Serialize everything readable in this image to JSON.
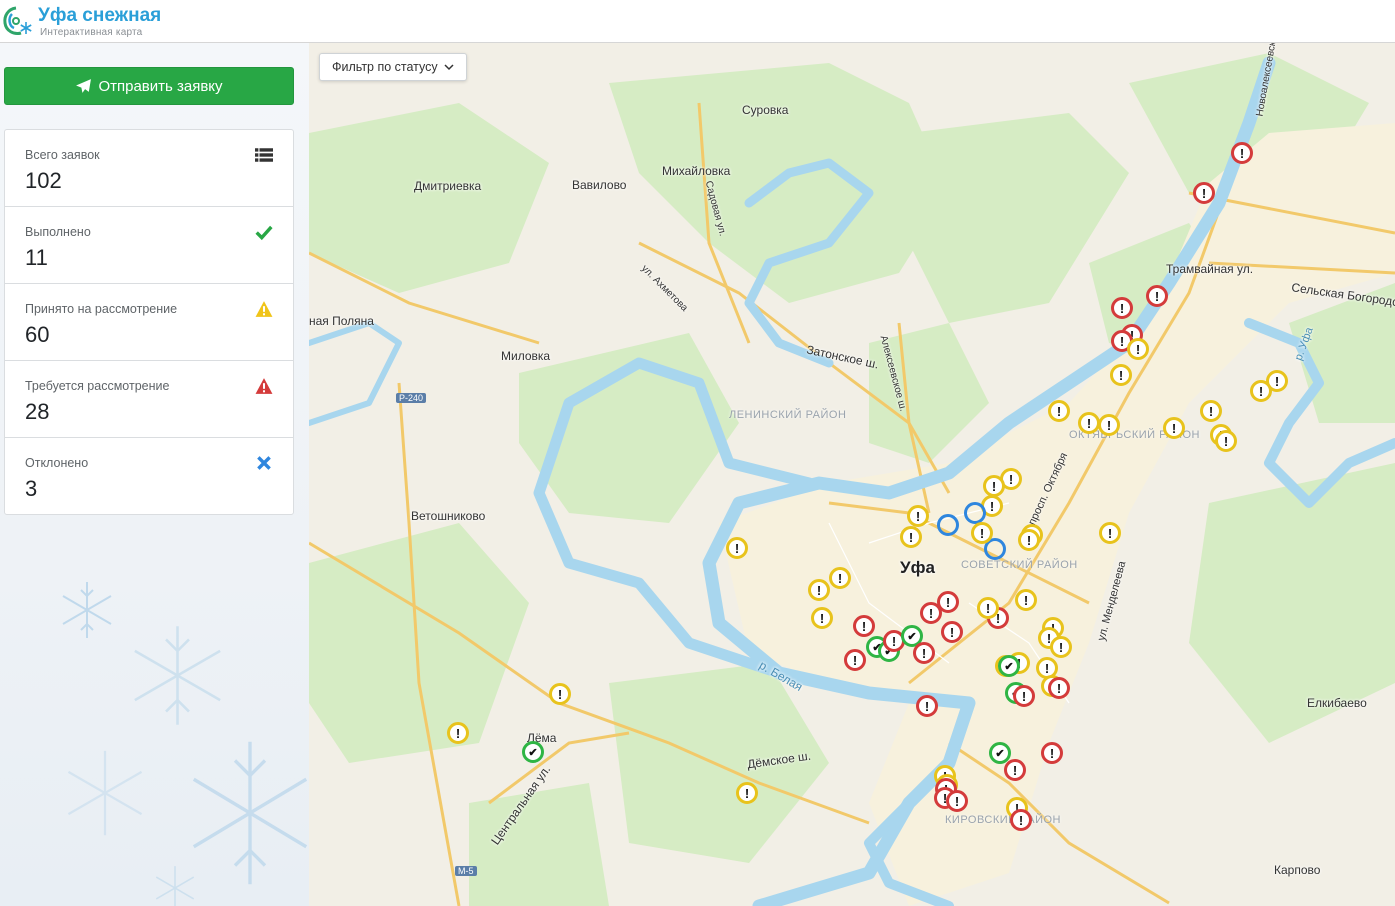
{
  "header": {
    "title": "Уфа снежная",
    "subtitle": "Интерактивная карта"
  },
  "sidebar": {
    "send_button": "Отправить заявку",
    "stats": [
      {
        "label": "Всего заявок",
        "value": "102",
        "icon": "list-icon",
        "color": "#333333"
      },
      {
        "label": "Выполнено",
        "value": "11",
        "icon": "check-icon",
        "color": "#28a745"
      },
      {
        "label": "Принято на рассмотрение",
        "value": "60",
        "icon": "warning-icon",
        "color": "#f0c419"
      },
      {
        "label": "Требуется рассмотрение",
        "value": "28",
        "icon": "alert-icon",
        "color": "#d43b3b"
      },
      {
        "label": "Отклонено",
        "value": "3",
        "icon": "cross-icon",
        "color": "#2e86de"
      }
    ]
  },
  "map": {
    "filter_label": "Фильтр по статусу",
    "city": "Уфа",
    "places": [
      "Суровка",
      "Михайловка",
      "Дмитриевка",
      "Вавилово",
      "Миловка",
      "Ветошниково",
      "Лёма",
      "Елкибаево",
      "Карпово",
      "Трамвайная ул.",
      "Сельская Богородская",
      "Затонское ш.",
      "Дёмское ш.",
      "р. Белая",
      "Центральная ул.",
      "Садовая ул.",
      "ул. Ахметова",
      "Алексеевское ш.",
      "просп. Октября",
      "ул. Менделеева",
      "ная Поляна",
      "Новоалексеевская",
      "р. Уфа"
    ],
    "districts": [
      "ЛЕНИНСКИЙ РАЙОН",
      "ОКТЯБРЬСКИЙ РАЙОН",
      "СОВЕТСКИЙ РАЙОН",
      "КИРОВСКИЙ РАЙОН"
    ],
    "road_shields": [
      "Р-240",
      "М-5"
    ]
  },
  "colors": {
    "accepted": "#e8c31c",
    "required": "#d43b3b",
    "done": "#2fb544",
    "rejected": "#2e86de",
    "accent": "#2a9fd8"
  }
}
